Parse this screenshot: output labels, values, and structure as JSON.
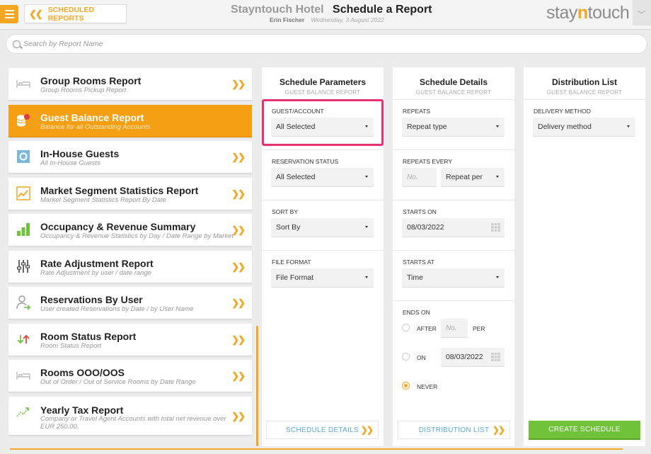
{
  "header": {
    "back_label": "SCHEDULED REPORTS",
    "hotel_name": "Stayntouch Hotel",
    "page_title": "Schedule a Report",
    "user_name": "Erin Fischer",
    "date": "Wednesday, 3 August 2022",
    "logo_left": "stay",
    "logo_accent": "n",
    "logo_right": "touch"
  },
  "search": {
    "placeholder": "Search by Report Name"
  },
  "reports": [
    {
      "title": "Group Rooms Report",
      "subtitle": "Group Rooms Pickup Report",
      "icon": "bed-icon",
      "active": false
    },
    {
      "title": "Guest Balance Report",
      "subtitle": "Balance for all Outstanding Accounts",
      "icon": "coins-icon",
      "active": true
    },
    {
      "title": "In-House Guests",
      "subtitle": "All In-House Guests",
      "icon": "in-house-icon",
      "active": false
    },
    {
      "title": "Market Segment Statistics Report",
      "subtitle": "Market Segment Statistics Report By Date",
      "icon": "line-chart-icon",
      "active": false
    },
    {
      "title": "Occupancy & Revenue Summary",
      "subtitle": "Occupancy & Revenue Statistics by Day / Date Range by Market",
      "icon": "bar-chart-icon",
      "active": false
    },
    {
      "title": "Rate Adjustment Report",
      "subtitle": "Rate Adjustment by user / date range",
      "icon": "sliders-icon",
      "active": false
    },
    {
      "title": "Reservations By User",
      "subtitle": "User created Reservations by Date / by User Name",
      "icon": "user-arrow-icon",
      "active": false
    },
    {
      "title": "Room Status Report",
      "subtitle": "Room Status Report",
      "icon": "up-down-arrows-icon",
      "active": false
    },
    {
      "title": "Rooms OOO/OOS",
      "subtitle": "Out of Order / Out of Service Rooms by Date Range",
      "icon": "bed-icon",
      "active": false
    },
    {
      "title": "Yearly Tax Report",
      "subtitle": "Company or Travel Agent Accounts with total net revenue over EUR 250.00.",
      "icon": "trend-up-icon",
      "active": false
    }
  ],
  "params": {
    "title": "Schedule Parameters",
    "subtitle": "GUEST BALANCE REPORT",
    "guest_account_label": "GUEST/ACCOUNT",
    "guest_account_value": "All Selected",
    "reservation_status_label": "RESERVATION STATUS",
    "reservation_status_value": "All Selected",
    "sort_by_label": "SORT BY",
    "sort_by_value": "Sort By",
    "file_format_label": "FILE FORMAT",
    "file_format_value": "File Format",
    "next_button": "SCHEDULE DETAILS"
  },
  "details": {
    "title": "Schedule Details",
    "subtitle": "GUEST BALANCE REPORT",
    "repeats_label": "REPEATS",
    "repeats_value": "Repeat type",
    "repeats_every_label": "REPEATS EVERY",
    "repeats_every_placeholder": "No.",
    "repeat_per_value": "Repeat per",
    "starts_on_label": "STARTS ON",
    "starts_on_value": "08/03/2022",
    "starts_at_label": "STARTS AT",
    "starts_at_value": "Time",
    "ends_on_label": "ENDS ON",
    "after_label": "AFTER",
    "after_placeholder": "No.",
    "per_label": "PER",
    "on_label": "ON",
    "ends_on_date": "08/03/2022",
    "never_label": "NEVER",
    "next_button": "DISTRIBUTION LIST"
  },
  "distribution": {
    "title": "Distribution List",
    "subtitle": "GUEST BALANCE REPORT",
    "delivery_label": "DELIVERY METHOD",
    "delivery_value": "Delivery method",
    "create_button": "CREATE SCHEDULE"
  },
  "colors": {
    "accent": "#f5a623",
    "highlight": "#e8326d",
    "create": "#6fc23a",
    "link": "#5aa9d6"
  }
}
